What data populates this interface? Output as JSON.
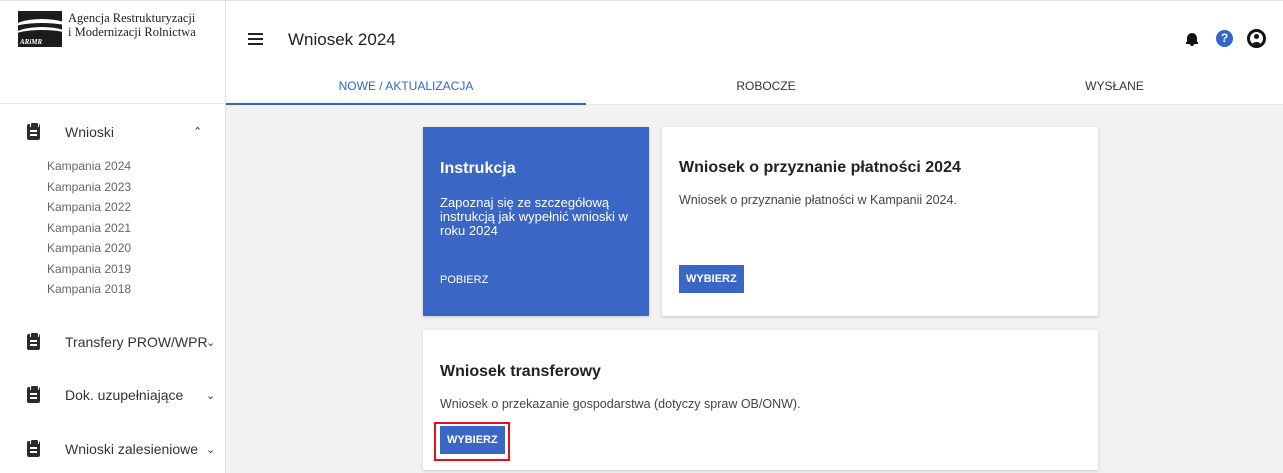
{
  "logo": {
    "abbr": "ARiMR",
    "line1": "Agencja Restrukturyzacji",
    "line2": "i Modernizacji Rolnictwa"
  },
  "header": {
    "title": "Wniosek 2024",
    "help_glyph": "?"
  },
  "tabs": [
    {
      "label": "NOWE / AKTUALIZACJA",
      "active": true
    },
    {
      "label": "ROBOCZE",
      "active": false
    },
    {
      "label": "WYSŁANE",
      "active": false
    }
  ],
  "sidebar": {
    "groups": [
      {
        "label": "Wnioski",
        "expanded": true,
        "items": [
          "Kampania 2024",
          "Kampania 2023",
          "Kampania 2022",
          "Kampania 2021",
          "Kampania 2020",
          "Kampania 2019",
          "Kampania 2018"
        ]
      },
      {
        "label": "Transfery PROW/WPR",
        "expanded": false
      },
      {
        "label": "Dok. uzupełniające",
        "expanded": false
      },
      {
        "label": "Wnioski zalesieniowe",
        "expanded": false
      }
    ]
  },
  "cards": {
    "instruction": {
      "title": "Instrukcja",
      "description": "Zapoznaj się ze szczegółową instrukcją jak wypełnić wnioski w roku 2024",
      "link": "POBIERZ"
    },
    "payment": {
      "title": "Wniosek o przyznanie płatności 2024",
      "description": "Wniosek o przyznanie płatności w Kampanii 2024.",
      "button": "WYBIERZ"
    },
    "transfer": {
      "title": "Wniosek transferowy",
      "description": "Wniosek o przekazanie gospodarstwa (dotyczy spraw OB/ONW).",
      "button": "WYBIERZ"
    }
  },
  "colors": {
    "accent": "#3a67c5",
    "highlight": "#e01020"
  },
  "icons": {
    "menu": "hamburger-icon",
    "notifications": "bell-icon",
    "help": "help-icon",
    "account": "user-icon",
    "group": "clipboard-icon"
  }
}
